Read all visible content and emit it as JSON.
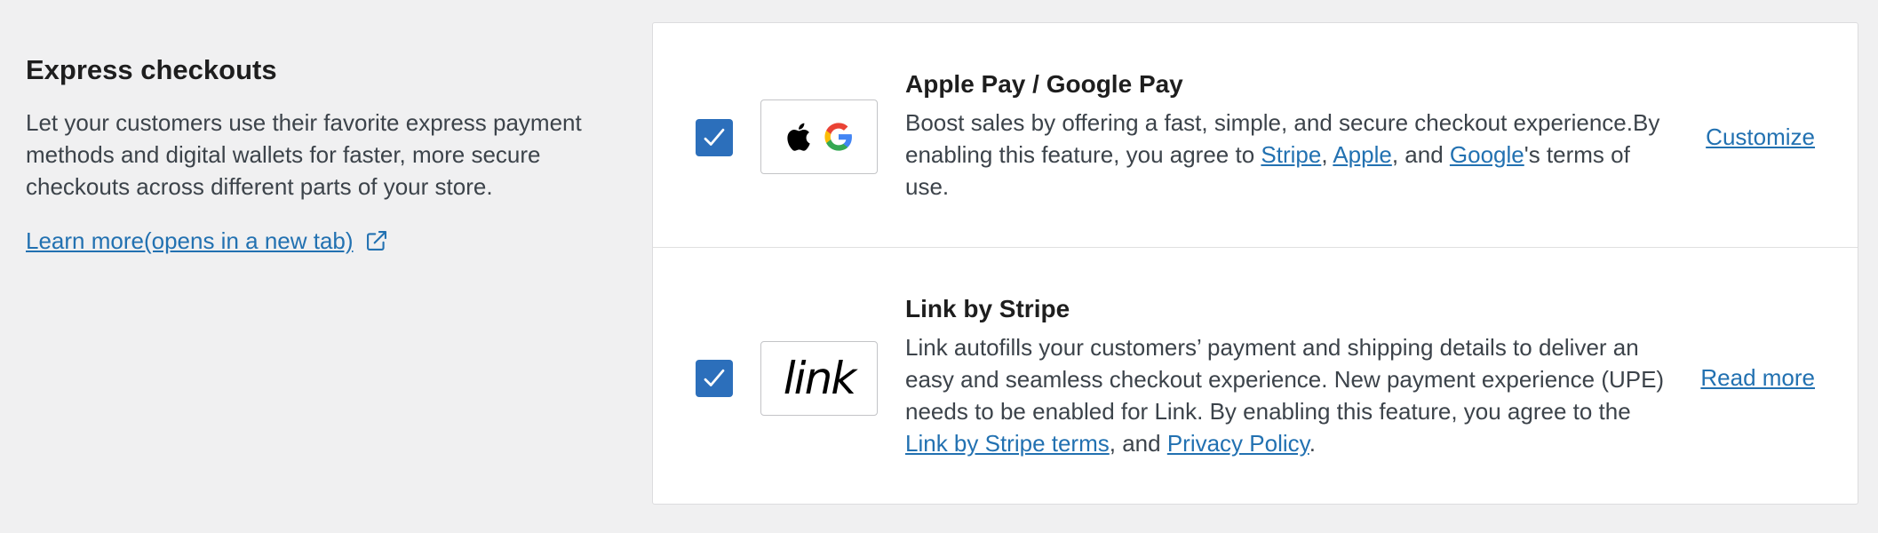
{
  "intro": {
    "title": "Express checkouts",
    "description": "Let your customers use their favorite express payment methods and digital wallets for faster, more secure checkouts across different parts of your store.",
    "learn_more": "Learn more(opens in a new tab)"
  },
  "methods": [
    {
      "title": "Apple Pay / Google Pay",
      "checked": true,
      "desc_part1": "Boost sales by offering a fast, simple, and secure checkout experience.By enabling this feature, you agree to ",
      "link1": "Stripe",
      "sep1": ", ",
      "link2": "Apple",
      "sep2": ", and ",
      "link3": "Google",
      "desc_end": "'s terms of use.",
      "action": "Customize",
      "logo_icons": [
        "apple-icon",
        "google-icon"
      ]
    },
    {
      "title": "Link by Stripe",
      "checked": true,
      "desc_part1": "Link autofills your customers’ payment and shipping details to deliver an easy and seamless checkout experience. New payment experience (UPE) needs to be enabled for Link. By enabling this feature, you agree to the ",
      "link1": "Link by Stripe terms",
      "sep1": ", and ",
      "link2": "Privacy Policy",
      "desc_end": ".",
      "action": "Read more",
      "logo_text": "link"
    }
  ],
  "colors": {
    "accent": "#2271b1",
    "checkbox": "#2c6fbb",
    "background": "#f0f0f1"
  }
}
